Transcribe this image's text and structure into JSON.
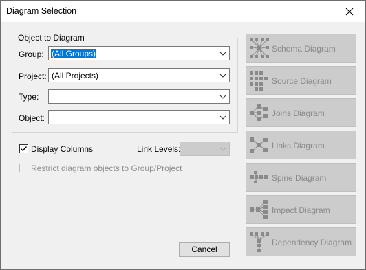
{
  "window": {
    "title": "Diagram Selection",
    "close_icon": "close-icon"
  },
  "object_group": {
    "legend": "Object to Diagram",
    "group_label": "Group:",
    "group_value": "(All Groups)",
    "project_label": "Project:",
    "project_value": "(All Projects)",
    "type_label": "Type:",
    "type_value": "",
    "object_label": "Object:",
    "object_value": ""
  },
  "options": {
    "display_columns_label": "Display Columns",
    "display_columns_checked": true,
    "link_levels_label": "Link Levels:",
    "link_levels_value": "",
    "restrict_label": "Restrict diagram objects to Group/Project",
    "restrict_checked": false
  },
  "buttons": {
    "cancel": "Cancel"
  },
  "diagram_buttons": [
    {
      "label": "Schema Diagram",
      "icon": "schema-diagram-icon"
    },
    {
      "label": "Source Diagram",
      "icon": "source-diagram-icon"
    },
    {
      "label": "Joins Diagram",
      "icon": "joins-diagram-icon"
    },
    {
      "label": "Links Diagram",
      "icon": "links-diagram-icon"
    },
    {
      "label": "Spine Diagram",
      "icon": "spine-diagram-icon"
    },
    {
      "label": "Impact Diagram",
      "icon": "impact-diagram-icon"
    },
    {
      "label": "Dependency Diagram",
      "icon": "dependency-diagram-icon"
    }
  ],
  "colors": {
    "selection": "#0078d7",
    "disabled_button": "#cccccc",
    "icon_gray": "#8a8a8a"
  }
}
